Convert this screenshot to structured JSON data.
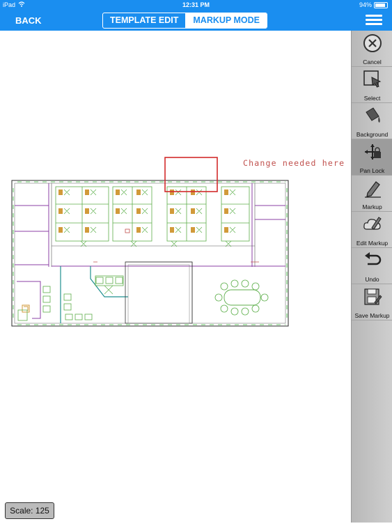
{
  "status_bar": {
    "device": "iPad",
    "time": "12:31 PM",
    "battery": "94%"
  },
  "nav": {
    "back_label": "BACK",
    "tabs": [
      {
        "label": "TEMPLATE EDIT",
        "selected": false
      },
      {
        "label": "MARKUP MODE",
        "selected": true
      }
    ]
  },
  "toolbar": {
    "items": [
      {
        "label": "Cancel",
        "icon": "cancel-icon"
      },
      {
        "label": "Select",
        "icon": "select-icon"
      },
      {
        "label": "Background",
        "icon": "paint-bucket-icon"
      },
      {
        "label": "Pan Lock",
        "icon": "pan-lock-icon",
        "active": true
      },
      {
        "label": "Markup",
        "icon": "pencil-icon"
      },
      {
        "label": "Edit Markup",
        "icon": "edit-markup-icon"
      },
      {
        "label": "Undo",
        "icon": "undo-icon"
      },
      {
        "label": "Save Markup",
        "icon": "save-icon"
      }
    ]
  },
  "markup": {
    "note": "Change needed here",
    "box_color": "#d22b2b",
    "text_color": "#c0504d"
  },
  "scale": {
    "label": "Scale: 125"
  },
  "colors": {
    "accent": "#1a8ef0",
    "toolbar_bg": "#c4c4c4"
  }
}
